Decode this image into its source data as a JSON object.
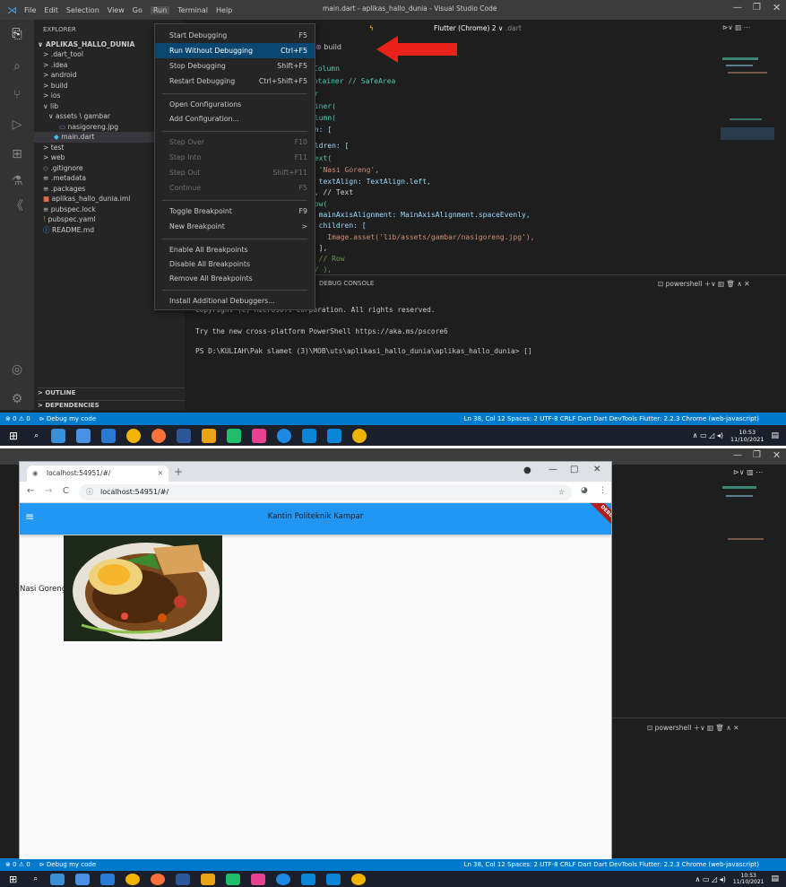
{
  "vscode": {
    "menu": [
      "File",
      "Edit",
      "Selection",
      "View",
      "Go",
      "Run",
      "Terminal",
      "Help"
    ],
    "window_title": "main.dart - aplikas_hallo_dunia - Visual Studio Code",
    "explorer_label": "EXPLORER",
    "project": "APLIKAS_HALLO_DUNIA",
    "tree": [
      "> .dart_tool",
      "> .idea",
      "> android",
      "> build",
      "> ios",
      "∨ lib",
      "∨ assets \\ gambar",
      "nasigoreng.jpg",
      "main.dart",
      "> test",
      "> web",
      ".gitignore",
      ".metadata",
      ".packages",
      "aplikas_hallo_dunia.iml",
      "pubspec.lock",
      "pubspec.yaml",
      "README.md"
    ],
    "outline_label": "OUTLINE",
    "dependencies_label": "DEPENDENCIES",
    "device_label": "Flutter (Chrome) 2 ∨",
    "tab_label": "build",
    "code_lines": [
      "Column",
      "ontainer // SafeArea",
      "ar",
      "ainer(",
      "olumn(",
      "en: [",
      "",
      "ildren: [",
      "Text(",
      "  'Nasi Goreng',",
      "  textAlign: TextAlign.left,",
      "), // Text",
      "Row(",
      "  mainAxisAlignment: MainAxisAlignment.spaceEvenly,",
      "  children: [",
      "    Image.asset('lib/assets/gambar/nasigoreng.jpg'),",
      "  ],",
      ") // Row",
      "// ),"
    ],
    "terminal_tab": "DEBUG CONSOLE",
    "terminal_shell": "powershell",
    "terminal_lines": [
      "Copyright (C) Microsoft Corporation. All rights reserved.",
      "Try the new cross-platform PowerShell https://aka.ms/pscore6",
      "PS D:\\KULIAH\\Pak slamet (3)\\MOB\\uts\\aplikasi_hallo_dunia\\aplikas_hallo_dunia> []"
    ],
    "run_menu": [
      {
        "label": "Start Debugging",
        "key": "F5",
        "disabled": false
      },
      {
        "label": "Run Without Debugging",
        "key": "Ctrl+F5",
        "disabled": false,
        "selected": true
      },
      {
        "label": "Stop Debugging",
        "key": "Shift+F5",
        "disabled": false
      },
      {
        "label": "Restart Debugging",
        "key": "Ctrl+Shift+F5",
        "disabled": false
      },
      {
        "label": "Open Configurations",
        "key": "",
        "disabled": false
      },
      {
        "label": "Add Configuration...",
        "key": "",
        "disabled": false
      },
      {
        "label": "Step Over",
        "key": "F10",
        "disabled": true
      },
      {
        "label": "Step Into",
        "key": "F11",
        "disabled": true
      },
      {
        "label": "Step Out",
        "key": "Shift+F11",
        "disabled": true
      },
      {
        "label": "Continue",
        "key": "F5",
        "disabled": true
      },
      {
        "label": "Toggle Breakpoint",
        "key": "F9",
        "disabled": false
      },
      {
        "label": "New Breakpoint",
        "key": ">",
        "disabled": false
      },
      {
        "label": "Enable All Breakpoints",
        "key": "",
        "disabled": false
      },
      {
        "label": "Disable All Breakpoints",
        "key": "",
        "disabled": false
      },
      {
        "label": "Remove All Breakpoints",
        "key": "",
        "disabled": false
      },
      {
        "label": "Install Additional Debuggers...",
        "key": "",
        "disabled": false
      }
    ],
    "status_left": [
      "⊗ 0 ⚠ 0",
      "Debug my code"
    ],
    "status_right": "Ln 38, Col 12   Spaces: 2   UTF-8   CRLF   Dart   Dart DevTools   Flutter: 2.2.3   Chrome (web-javascript)",
    "clock_time": "10:53",
    "clock_date": "11/10/2021"
  },
  "browser": {
    "tab_title": "localhost:54951/#/",
    "address": "localhost:54951/#/",
    "app_title": "Kantin Politeknik Kampar",
    "debug_banner": "DEBUG",
    "item_text": "Nasi Goreng"
  },
  "colors": {
    "accent": "#007acc",
    "appbar": "#2196f3",
    "arrow": "#e8221b"
  }
}
